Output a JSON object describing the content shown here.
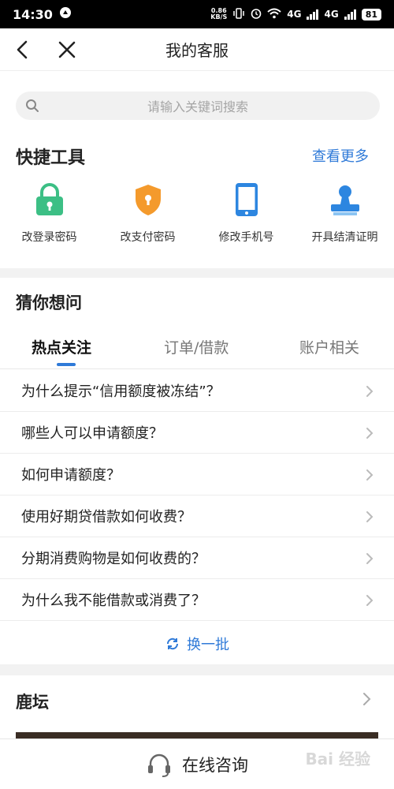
{
  "status_bar": {
    "time": "14:30",
    "speed_value": "0.86",
    "speed_unit": "KB/S",
    "network_1": "4G",
    "network_2": "4G",
    "battery": "81"
  },
  "nav": {
    "title": "我的客服",
    "back_icon": "chevron-left-icon",
    "close_icon": "close-icon"
  },
  "search": {
    "placeholder": "请输入关键词搜索"
  },
  "quick_tools": {
    "title": "快捷工具",
    "more": "查看更多",
    "items": [
      {
        "label": "改登录密码",
        "icon": "lock-icon",
        "color": "#3cbf85"
      },
      {
        "label": "改支付密码",
        "icon": "shield-icon",
        "color": "#f49a2c"
      },
      {
        "label": "修改手机号",
        "icon": "phone-icon",
        "color": "#2d86e0"
      },
      {
        "label": "开具结清证明",
        "icon": "stamp-icon",
        "color": "#2d86e0"
      }
    ]
  },
  "guess": {
    "title": "猜你想问",
    "tabs": [
      {
        "label": "热点关注"
      },
      {
        "label": "订单/借款"
      },
      {
        "label": "账户相关"
      }
    ],
    "questions": [
      "为什么提示“信用额度被冻结”？",
      "哪些人可以申请额度？",
      "如何申请额度？",
      "使用好期贷借款如何收费？",
      "分期消费购物是如何收费的？",
      "为什么我不能借款或消费了？"
    ],
    "refresh": "换一批"
  },
  "forum": {
    "title": "鹿坛"
  },
  "bottom": {
    "consult": "在线咨询"
  },
  "watermark": "Bai 经验",
  "colors": {
    "accent": "#2f7ad8"
  }
}
